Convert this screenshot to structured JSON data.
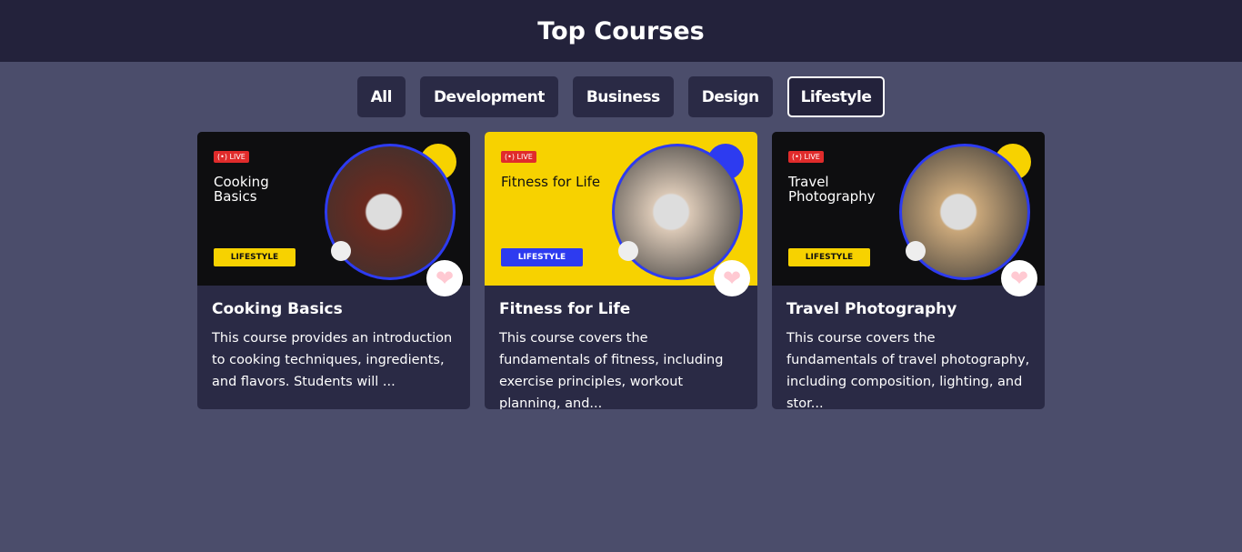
{
  "header": {
    "title": "Top Courses"
  },
  "filters": [
    {
      "label": "All"
    },
    {
      "label": "Development"
    },
    {
      "label": "Business"
    },
    {
      "label": "Design"
    },
    {
      "label": "Lifestyle",
      "active": true
    }
  ],
  "live_label": "(•) LIVE",
  "courses": [
    {
      "title": "Cooking Basics",
      "thumb_title": "Cooking Basics",
      "category": "LIFESTYLE",
      "description": "This course provides an introduction to cooking techniques, ingredients, and flavors. Students will ...",
      "bg": "#0e0e10",
      "text": "#ffffff",
      "tag_bg": "#f7d200",
      "tag_text": "#111111",
      "photo": "#6b2a1f"
    },
    {
      "title": "Fitness for Life",
      "thumb_title": "Fitness for Life",
      "category": "LIFESTYLE",
      "description": "This course covers the fundamentals of fitness, including exercise principles, workout planning, and...",
      "bg": "#f7d200",
      "text": "#111111",
      "tag_bg": "#2d3bf0",
      "tag_text": "#ffffff",
      "photo": "#d9c7b5"
    },
    {
      "title": "Travel Photography",
      "thumb_title": "Travel Photography",
      "category": "LIFESTYLE",
      "description": "This course covers the fundamentals of travel photography, including composition, lighting, and stor...",
      "bg": "#0e0e10",
      "text": "#ffffff",
      "tag_bg": "#f7d200",
      "tag_text": "#111111",
      "photo": "#c9a77a"
    }
  ],
  "colors": {
    "accent_yellow": "#f7d200",
    "accent_blue": "#2d3bf0",
    "heart": "#ffc9d2"
  }
}
